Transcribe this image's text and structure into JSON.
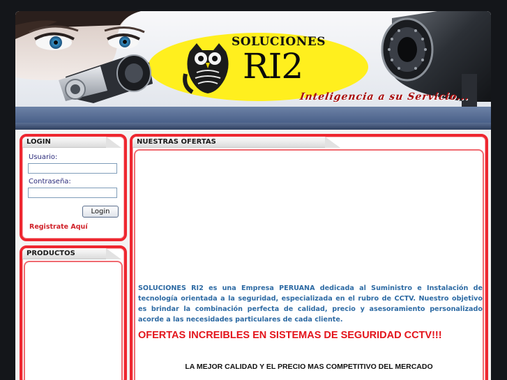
{
  "header": {
    "logo_title": "SOLUCIONES",
    "logo_name": "RI2",
    "slogan": "Inteligencia a su Servicio..."
  },
  "login": {
    "title": "LOGIN",
    "user_label": "Usuario:",
    "password_label": "Contraseña:",
    "user_value": "",
    "password_value": "",
    "button_label": "Login",
    "register_link": "Registrate Aquí"
  },
  "products": {
    "title": "PRODUCTOS"
  },
  "offers": {
    "title": "NUESTRAS OFERTAS",
    "description": "SOLUCIONES RI2 es una Empresa PERUANA dedicada al Suministro e Instalación de tecnología orientada a la seguridad, especializada en el rubro de CCTV. Nuestro objetivo es brindar la combinación perfecta de calidad, precio y asesoramiento personalizado acorde a las necesidades particulares de cada cliente.",
    "headline": "OFERTAS INCREIBLES EN SISTEMAS DE SEGURIDAD CCTV!!!",
    "subline": "LA MEJOR CALIDAD Y EL PRECIO MAS COMPETITIVO DEL MERCADO"
  },
  "colors": {
    "accent_red": "#ee2730",
    "logo_yellow": "#ffef1e",
    "text_blue": "#2d6aa3",
    "background": "#14161a"
  },
  "icons": {
    "owl": "owl-logo-icon",
    "camera": "security-camera-icon"
  }
}
